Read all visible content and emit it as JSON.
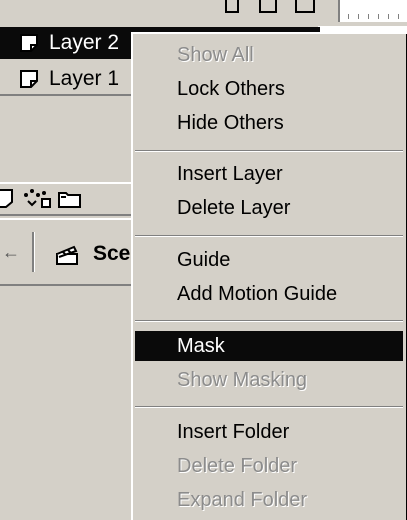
{
  "layers": [
    {
      "label": "Layer 2",
      "selected": true,
      "icon": "layer-page-icon"
    },
    {
      "label": "Layer 1",
      "selected": false,
      "icon": "layer-page-icon"
    }
  ],
  "scene": {
    "label": "Sce",
    "icon": "clapperboard-icon"
  },
  "toolbar_icons": [
    "insert-layer-icon",
    "add-motion-guide-icon",
    "insert-folder-icon"
  ],
  "menu": {
    "show_all": "Show All",
    "lock_others": "Lock Others",
    "hide_others": "Hide Others",
    "insert_layer": "Insert Layer",
    "delete_layer": "Delete Layer",
    "guide": "Guide",
    "add_motion_guide": "Add Motion Guide",
    "mask": "Mask",
    "show_masking": "Show Masking",
    "insert_folder": "Insert Folder",
    "delete_folder": "Delete Folder",
    "expand_folder": "Expand Folder"
  },
  "colors": {
    "highlight": "#0a0a0a",
    "disabled_text": "#8c8c8c",
    "panel": "#d4d0c8"
  }
}
